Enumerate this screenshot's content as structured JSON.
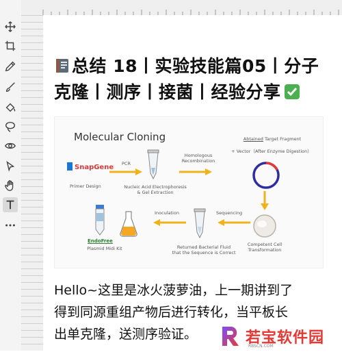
{
  "toolbar": {
    "tools": [
      "move-icon",
      "crop-icon",
      "eyedropper-icon",
      "brush-icon",
      "fill-icon",
      "lasso-icon",
      "eye-icon",
      "select-icon",
      "hand-icon",
      "text-icon",
      "more-icon"
    ],
    "active_tool": "text-icon"
  },
  "post": {
    "title_line1": "总结 18丨实验技能篇05丨分子",
    "title_line2": "克隆丨测序丨接菌丨经验分享",
    "body_line1": "Hello~这里是冰火菠萝油，上一期讲到了",
    "body_line2": "得到同源重组产物后进行转化，当平板长",
    "body_line3": "出单克隆，送测序验证。"
  },
  "figure": {
    "title": "Molecular Cloning",
    "snapgene": "SnapGene",
    "primer_design": "Primer Design",
    "pcr": "PCR",
    "electrophoresis_1": "Nucleic Acid Electrophoresis",
    "electrophoresis_2": "& Gel Extraction",
    "homologous_1": "Homologous",
    "homologous_2": "Recombination",
    "target_fragment_1": "Abtained",
    "target_fragment_2": " Target Fragment",
    "vector": "+ Vector（After Enzyme Digestion）",
    "inoculation": "Inoculation",
    "sequencing": "Sequencing",
    "endofree": "EndoFree",
    "plasmid_kit": "Plasmid Midi Kit",
    "returned_1": "Returned Bacterial Fluid",
    "returned_2": "that the Sequence is Correct",
    "competent_1": "Competent Cell",
    "competent_2": "Transformation"
  },
  "watermark": {
    "text": "若宝软件园",
    "url": "RBSCN.COM"
  },
  "colors": {
    "arrow": "#f0b21a",
    "watermark_red": "#e53935",
    "plasmid_blue": "#2e2ea0"
  }
}
